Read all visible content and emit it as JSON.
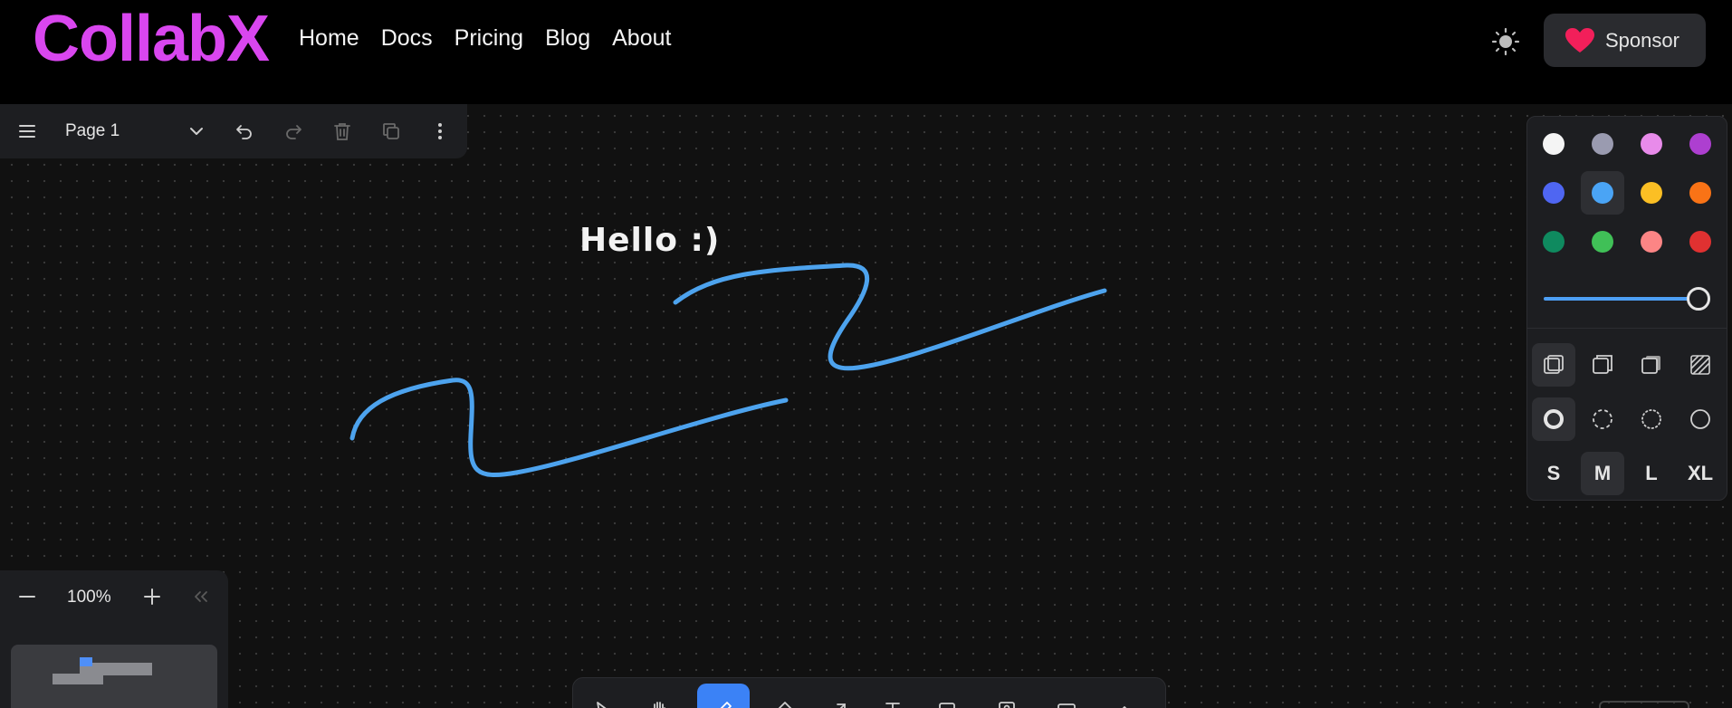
{
  "header": {
    "logo": "CollabX",
    "nav": [
      "Home",
      "Docs",
      "Pricing",
      "Blog",
      "About"
    ],
    "sponsor_label": "Sponsor"
  },
  "pagebar": {
    "page_name": "Page 1",
    "icons": [
      "menu-icon",
      "chevron-down-icon",
      "undo-icon",
      "redo-icon",
      "trash-icon",
      "duplicate-icon",
      "more-vertical-icon"
    ]
  },
  "canvas": {
    "text": "Hello :)",
    "stroke_color": "#4da3ee"
  },
  "zoom": {
    "value": "100%"
  },
  "style_panel": {
    "colors": [
      "#f4f4f4",
      "#9a9bb0",
      "#e88bea",
      "#ad3fd0",
      "#4f66f2",
      "#4aa4f5",
      "#fbbf24",
      "#f97316",
      "#0f8a5f",
      "#40c057",
      "#fc8585",
      "#e03131"
    ],
    "selected_color_index": 5,
    "opacity_value": 1.0,
    "fill_options": [
      "fill-none-icon",
      "fill-semi-icon",
      "fill-solid-icon",
      "fill-pattern-icon"
    ],
    "dash_options": [
      "dash-draw-icon",
      "dash-dashed-icon",
      "dash-dotted-icon",
      "dash-solid-icon"
    ],
    "sizes": [
      "S",
      "M",
      "L",
      "XL"
    ],
    "selected_size": "M"
  },
  "toolbar": {
    "tools": [
      "select-tool-icon",
      "hand-tool-icon",
      "draw-tool-icon",
      "eraser-tool-icon",
      "arrow-tool-icon",
      "text-tool-icon",
      "note-tool-icon",
      "asset-tool-icon",
      "rectangle-tool-icon",
      "more-tools-icon"
    ],
    "active_tool": "draw-tool-icon"
  }
}
